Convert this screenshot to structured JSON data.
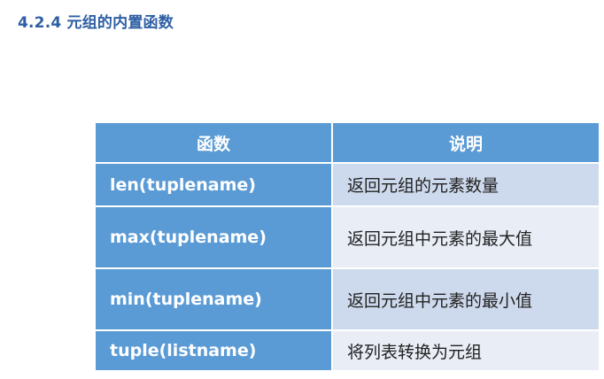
{
  "heading": "4.2.4 元组的内置函数",
  "table": {
    "headers": [
      "函数",
      "说明"
    ],
    "rows": [
      {
        "function": "len(tuplename)",
        "description": "返回元组的元素数量"
      },
      {
        "function": "max(tuplename)",
        "description": "返回元组中元素的最大值"
      },
      {
        "function": "min(tuplename)",
        "description": "返回元组中元素的最小值"
      },
      {
        "function": "tuple(listname)",
        "description": "将列表转换为元组"
      }
    ]
  },
  "colors": {
    "heading": "#2e5fa3",
    "header_fill": "#5b9bd5",
    "row_dark": "#cdd9ec",
    "row_light": "#e8edf6"
  }
}
